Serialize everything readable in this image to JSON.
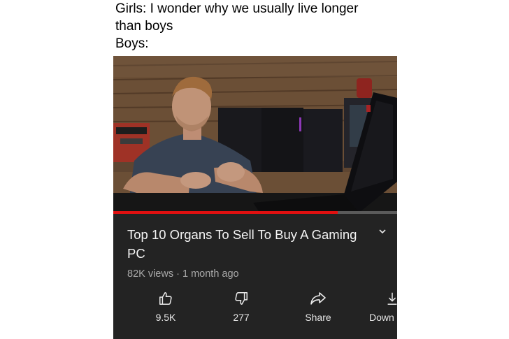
{
  "caption": {
    "line1": "Girls: I wonder why we usually live longer",
    "line2": "than boys",
    "line3": "Boys:"
  },
  "video": {
    "title": "Top 10 Organs To Sell To Buy A Gaming PC",
    "views": "82K views",
    "separator": " · ",
    "age": "1 month ago",
    "progress_fraction": 0.79
  },
  "actions": {
    "like": {
      "label": "9.5K",
      "icon": "thumbs-up-icon"
    },
    "dislike": {
      "label": "277",
      "icon": "thumbs-down-icon"
    },
    "share": {
      "label": "Share",
      "icon": "share-icon"
    },
    "download": {
      "label": "Down",
      "icon": "download-icon"
    }
  },
  "colors": {
    "panel": "#232323",
    "progress": "#e01010",
    "meta_text": "#a9a9a9"
  }
}
